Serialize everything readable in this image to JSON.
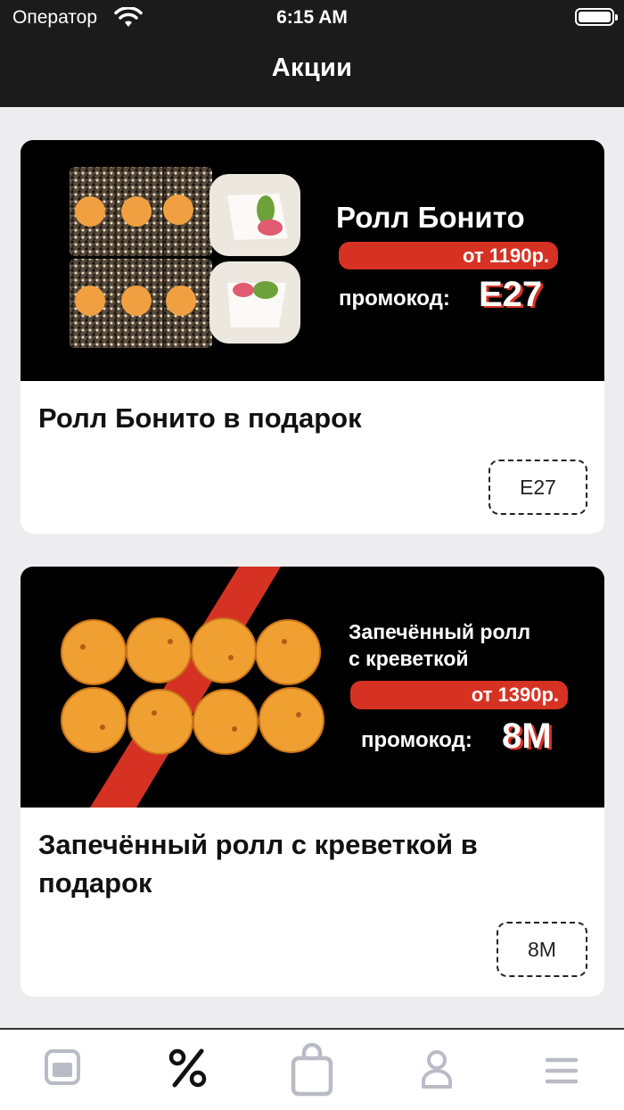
{
  "status_bar": {
    "carrier": "Оператор",
    "time": "6:15 AM"
  },
  "nav": {
    "title": "Акции"
  },
  "promos": [
    {
      "banner_title": "Ролл Бонито",
      "banner_price": "от 1190р.",
      "banner_promo_label": "промокод:",
      "banner_code": "E27",
      "title": "Ролл Бонито в подарок",
      "code": "E27"
    },
    {
      "banner_title_line1": "Запечённый ролл",
      "banner_title_line2": "с креветкой",
      "banner_price": "от 1390р.",
      "banner_promo_label": "промокод:",
      "banner_code": "8M",
      "title": "Запечённый ролл с креветкой в подарок",
      "code": "8M"
    }
  ],
  "tabbar": {
    "items": [
      {
        "icon": "menu-book-icon",
        "active": false
      },
      {
        "icon": "percent-icon",
        "active": true
      },
      {
        "icon": "shopping-bag-icon",
        "active": false
      },
      {
        "icon": "profile-icon",
        "active": false
      },
      {
        "icon": "hamburger-menu-icon",
        "active": false
      }
    ]
  },
  "colors": {
    "accent": "#d63223",
    "topbar": "#1b1b1b",
    "background": "#ededf0",
    "tab_inactive": "#b9bcc6"
  }
}
